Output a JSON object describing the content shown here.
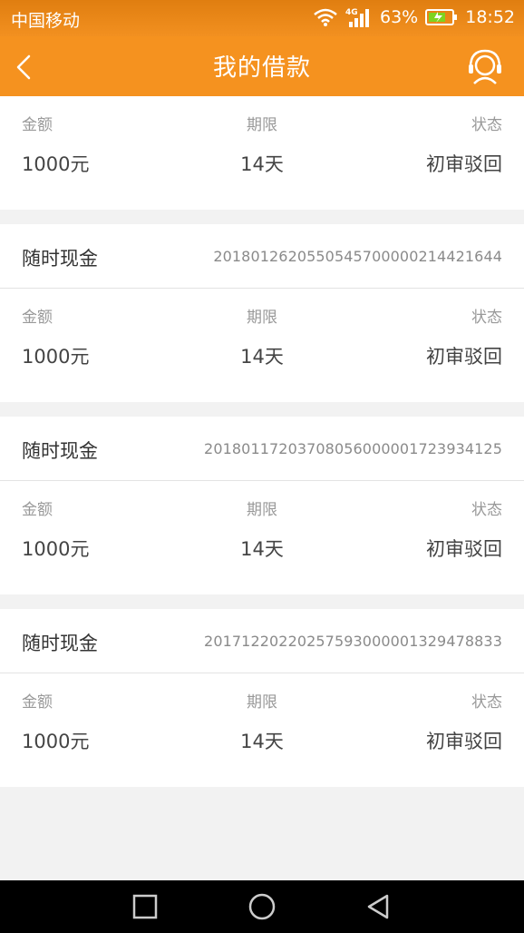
{
  "status_bar": {
    "carrier": "中国移动",
    "network": "4G",
    "battery": "63%",
    "time": "18:52"
  },
  "header": {
    "title": "我的借款"
  },
  "top_partial": {
    "amount_label": "金额",
    "term_label": "期限",
    "status_label": "状态",
    "amount": "1000元",
    "term": "14天",
    "status": "初审驳回"
  },
  "loans": [
    {
      "product": "随时现金",
      "order_no": "2018012620550545700000214421644",
      "amount_label": "金额",
      "term_label": "期限",
      "status_label": "状态",
      "amount": "1000元",
      "term": "14天",
      "status": "初审驳回"
    },
    {
      "product": "随时现金",
      "order_no": "2018011720370805600000172393412 5",
      "amount_label": "金额",
      "term_label": "期限",
      "status_label": "状态",
      "amount": "1000元",
      "term": "14天",
      "status": "初审驳回"
    },
    {
      "product": "随时现金",
      "order_no": "2017122022025759300000132947883 3",
      "amount_label": "金额",
      "term_label": "期限",
      "status_label": "状态",
      "amount": "1000元",
      "term": "14天",
      "status": "初审驳回"
    }
  ]
}
